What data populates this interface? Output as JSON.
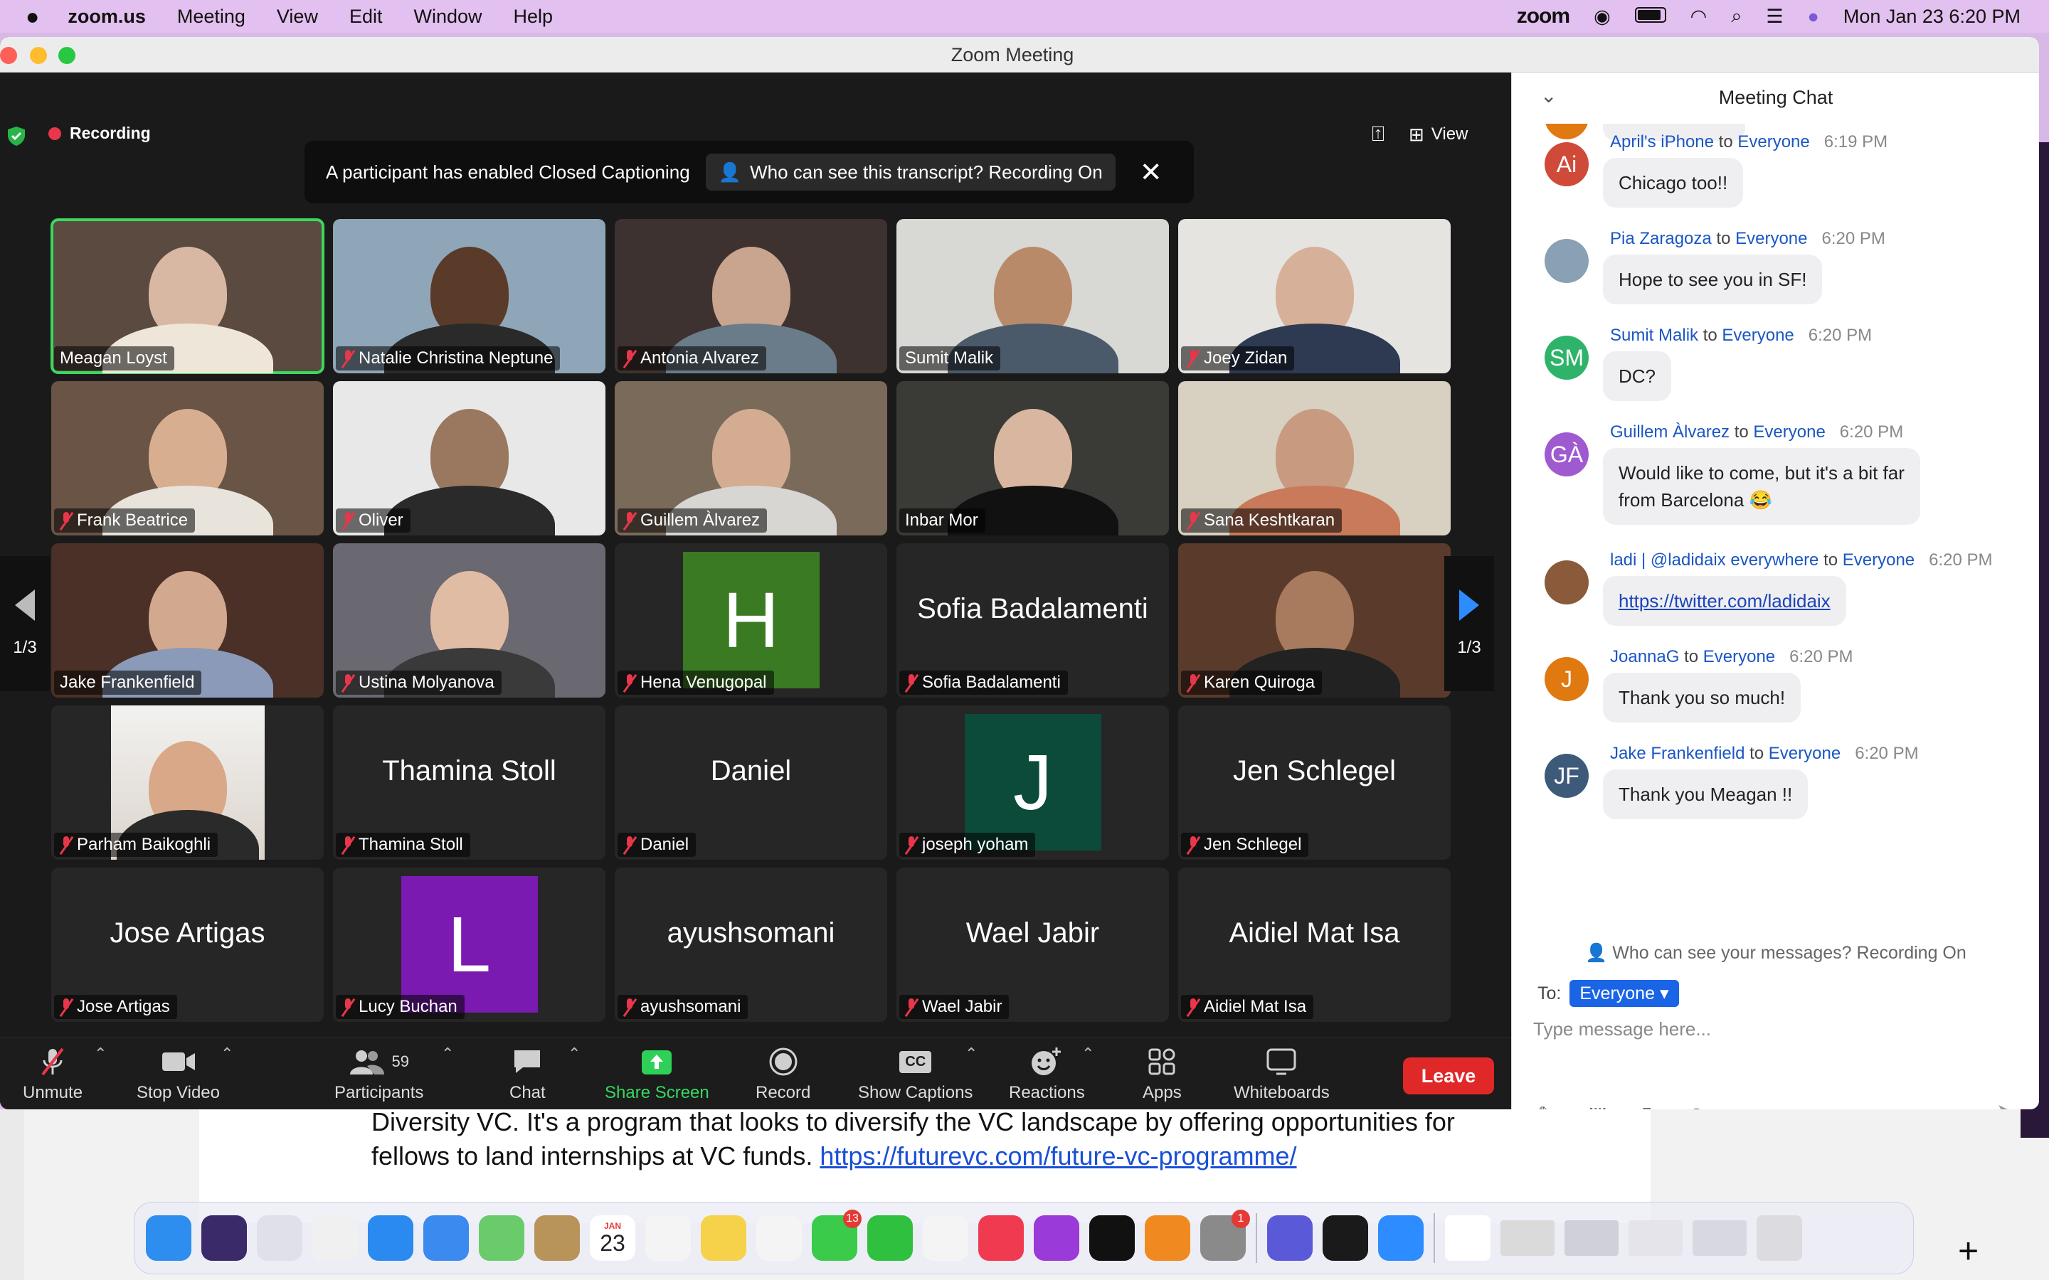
{
  "menubar": {
    "app": "zoom.us",
    "items": [
      "Meeting",
      "View",
      "Edit",
      "Window",
      "Help"
    ],
    "right_brand": "zoom",
    "clock": "Mon Jan 23  6:20 PM"
  },
  "window": {
    "title": "Zoom Meeting"
  },
  "meeting": {
    "recording_label": "Recording",
    "cc_banner": {
      "text": "A participant has enabled Closed Captioning",
      "chip": "Who can see this transcript? Recording On"
    },
    "view_label": "View",
    "pager": {
      "left": "1/3",
      "right": "1/3"
    }
  },
  "tiles": [
    {
      "name": "Meagan Loyst",
      "muted": false,
      "kind": "video",
      "skin": "#d9b8a3",
      "shirt": "#efe6da",
      "bg": "#5a4a40",
      "active": true
    },
    {
      "name": "Natalie Christina Neptune",
      "muted": true,
      "kind": "video",
      "skin": "#5a3a28",
      "shirt": "#2a2a2a",
      "bg": "#8fa6b8"
    },
    {
      "name": "Antonia Alvarez",
      "muted": true,
      "kind": "video",
      "skin": "#c9a48e",
      "shirt": "#6a7c8a",
      "bg": "#3e3230"
    },
    {
      "name": "Sumit Malik",
      "muted": false,
      "kind": "video",
      "skin": "#b88a6a",
      "shirt": "#4a5a6a",
      "bg": "#d8d8d4"
    },
    {
      "name": "Joey Zidan",
      "muted": true,
      "kind": "video",
      "skin": "#d6b098",
      "shirt": "#2e3a52",
      "bg": "#e6e4e0"
    },
    {
      "name": "Frank Beatrice",
      "muted": true,
      "kind": "video",
      "skin": "#d8ae90",
      "shirt": "#e8e4dc",
      "bg": "#6a5446"
    },
    {
      "name": "Oliver",
      "muted": true,
      "kind": "video",
      "skin": "#9a7860",
      "shirt": "#2a2a2a",
      "bg": "#e8e8e8"
    },
    {
      "name": "Guillem Àlvarez",
      "muted": true,
      "kind": "video",
      "skin": "#d4ac92",
      "shirt": "#d8d6d2",
      "bg": "#7a6a5a"
    },
    {
      "name": "Inbar Mor",
      "muted": false,
      "kind": "video",
      "skin": "#d8b6a0",
      "shirt": "#111111",
      "bg": "#3a3a36"
    },
    {
      "name": "Sana Keshtkaran",
      "muted": true,
      "kind": "video",
      "skin": "#c89a80",
      "shirt": "#c87a5a",
      "bg": "#d8d0c0"
    },
    {
      "name": "Jake Frankenfield",
      "muted": false,
      "kind": "video",
      "skin": "#d2a88e",
      "shirt": "#8a9ab8",
      "bg": "#4a3026"
    },
    {
      "name": "Ustina Molyanova",
      "muted": true,
      "kind": "video",
      "skin": "#e0bca4",
      "shirt": "#3a3a3a",
      "bg": "#6a6870"
    },
    {
      "name": "Hena Venugopal",
      "muted": true,
      "kind": "avatar",
      "letter": "H",
      "color": "#3a7a22"
    },
    {
      "name": "Sofia Badalamenti",
      "muted": true,
      "kind": "text"
    },
    {
      "name": "Karen Quiroga",
      "muted": true,
      "kind": "video",
      "skin": "#a87a5e",
      "shirt": "#222222",
      "bg": "#5a3a2a"
    },
    {
      "name": "Parham Baikoghli",
      "muted": true,
      "kind": "photo",
      "skin": "#d8a888",
      "shirt": "#2a2a2a"
    },
    {
      "name": "Thamina Stoll",
      "muted": true,
      "kind": "text"
    },
    {
      "name": "Daniel",
      "muted": true,
      "kind": "text"
    },
    {
      "name": "joseph yoham",
      "muted": true,
      "kind": "avatar",
      "letter": "J",
      "color": "#0c4a3a"
    },
    {
      "name": "Jen Schlegel",
      "muted": true,
      "kind": "text"
    },
    {
      "name": "Jose Artigas",
      "muted": true,
      "kind": "text"
    },
    {
      "name": "Lucy Buchan",
      "muted": true,
      "kind": "avatar",
      "letter": "L",
      "color": "#7a1ab0"
    },
    {
      "name": "ayushsomani",
      "muted": true,
      "kind": "text"
    },
    {
      "name": "Wael Jabir",
      "muted": true,
      "kind": "text"
    },
    {
      "name": "Aidiel Mat Isa",
      "muted": true,
      "kind": "text"
    }
  ],
  "toolbar": {
    "unmute": "Unmute",
    "stop_video": "Stop Video",
    "participants": "Participants",
    "participants_count": "59",
    "chat": "Chat",
    "share_screen": "Share Screen",
    "record": "Record",
    "show_captions": "Show Captions",
    "cc_glyph": "CC",
    "reactions": "Reactions",
    "apps": "Apps",
    "whiteboards": "Whiteboards",
    "leave": "Leave"
  },
  "chat": {
    "title": "Meeting Chat",
    "messages": [
      {
        "from": "April's iPhone",
        "to": "Everyone",
        "time": "6:19 PM",
        "text": "Chicago too!!",
        "initials": "Ai",
        "color": "#d04a3a"
      },
      {
        "from": "Pia Zaragoza",
        "to": "Everyone",
        "time": "6:20 PM",
        "text": "Hope to see you in SF!",
        "initials": "",
        "color": "#8aa0b4"
      },
      {
        "from": "Sumit Malik",
        "to": "Everyone",
        "time": "6:20 PM",
        "text": "DC?",
        "initials": "SM",
        "color": "#2fb36a"
      },
      {
        "from": "Guillem Àlvarez",
        "to": "Everyone",
        "time": "6:20 PM",
        "text": "Would like to come, but it's a bit far",
        "text2": "from Barcelona 😂",
        "initials": "GÀ",
        "color": "#a05ad0"
      },
      {
        "from": "ladi | @ladidaix everywhere",
        "to": "Everyone",
        "time": "6:20 PM",
        "link": "https://twitter.com/ladidaix",
        "initials": "",
        "color": "#8a5a3a"
      },
      {
        "from": "JoannaG",
        "to": "Everyone",
        "time": "6:20 PM",
        "text": "Thank you so much!",
        "initials": "J",
        "color": "#e07a10"
      },
      {
        "from": "Jake Frankenfield",
        "to": "Everyone",
        "time": "6:20 PM",
        "text": "Thank you Meagan !!",
        "initials": "JF",
        "color": "#3e5a7a"
      }
    ],
    "to_word": "to",
    "visibility_note": "Who can see your messages? Recording On",
    "to_label": "To:",
    "to_value": "Everyone",
    "placeholder": "Type message here..."
  },
  "document": {
    "line1": "Diversity VC. It's a program that looks to diversify the VC landscape by offering opportunities for",
    "line2_prefix": "fellows to land internships at VC funds. ",
    "link": "https://futurevc.com/future-vc-programme/"
  },
  "dock": {
    "apps": [
      {
        "name": "finder-icon",
        "color": "#2e8ef0"
      },
      {
        "name": "siri-icon",
        "color": "#3a2a6a"
      },
      {
        "name": "launchpad-icon",
        "color": "#e0e0e8"
      },
      {
        "name": "chrome-icon",
        "color": "#f0f0f0"
      },
      {
        "name": "safari-icon",
        "color": "#2a8af0"
      },
      {
        "name": "mail-icon",
        "color": "#3a8af0"
      },
      {
        "name": "maps-icon",
        "color": "#6acb6a"
      },
      {
        "name": "contacts-icon",
        "color": "#b8935a"
      },
      {
        "name": "calendar-icon",
        "color": "#ffffff"
      },
      {
        "name": "reminders-icon",
        "color": "#f4f4f4"
      },
      {
        "name": "notes-icon",
        "color": "#f6d24a"
      },
      {
        "name": "photos-icon",
        "color": "#f4f4f4"
      },
      {
        "name": "messages-icon",
        "color": "#3acb4a"
      },
      {
        "name": "facetime-icon",
        "color": "#30c040"
      },
      {
        "name": "news-icon",
        "color": "#f4f4f4"
      },
      {
        "name": "music-icon",
        "color": "#f03a50"
      },
      {
        "name": "podcasts-icon",
        "color": "#9a3ad8"
      },
      {
        "name": "tv-icon",
        "color": "#111111"
      },
      {
        "name": "books-icon",
        "color": "#f08a20"
      },
      {
        "name": "settings-icon",
        "color": "#8a8a8a"
      },
      {
        "name": "teams-icon",
        "color": "#5a5ad8"
      },
      {
        "name": "spotify-icon",
        "color": "#1a1a1a"
      },
      {
        "name": "zoom-icon",
        "color": "#2d8cff"
      },
      {
        "name": "document-icon",
        "color": "#ffffff"
      },
      {
        "name": "window-thumb-icon",
        "color": "#dadada"
      },
      {
        "name": "window-thumb-icon",
        "color": "#d0d0d8"
      },
      {
        "name": "window-thumb-icon",
        "color": "#e4e4ea"
      },
      {
        "name": "window-thumb-icon",
        "color": "#d8d8e0"
      },
      {
        "name": "trash-icon",
        "color": "#dcdce0"
      }
    ],
    "messages_badge": "13",
    "settings_badge": "1",
    "calendar_month": "JAN",
    "calendar_day": "23"
  }
}
